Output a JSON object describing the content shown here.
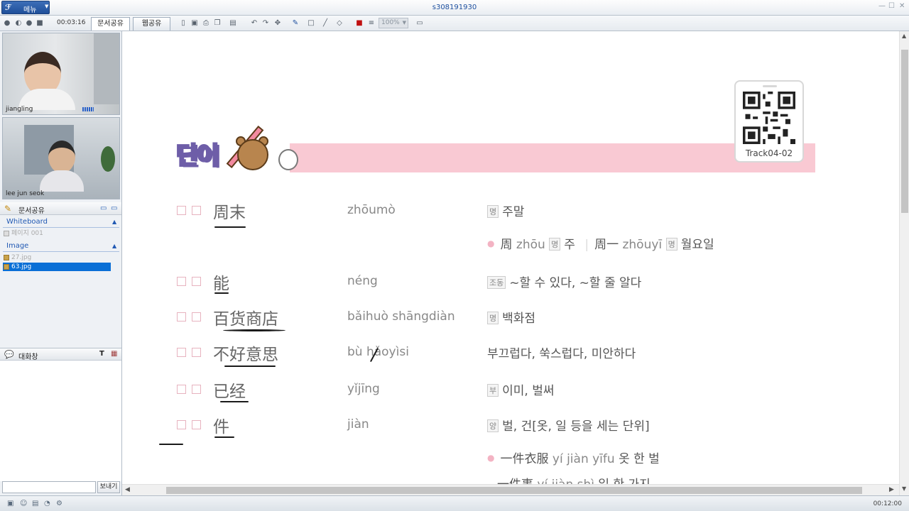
{
  "window": {
    "menu_label": "메뉴",
    "title": "s308191930"
  },
  "toolbar": {
    "elapsed": "00:03:16",
    "tab_doc_share": "문서공유",
    "tab_web_share": "웹공유",
    "zoom": "100%"
  },
  "participants": [
    {
      "name": "jiangling"
    },
    {
      "name": "lee jun seok"
    }
  ],
  "doc_panel": {
    "title": "문서공유",
    "whiteboard_label": "Whiteboard",
    "whiteboard_items": [
      "페이지 001"
    ],
    "image_label": "Image",
    "image_items": [
      "27.jpg",
      "63.jpg"
    ],
    "selected_item": "63.jpg"
  },
  "chat": {
    "title": "대화창",
    "send_label": "보내기"
  },
  "status": {
    "time": "00:12:00"
  },
  "document": {
    "heading": "단어",
    "qr_label": "Track04-02",
    "vocab": [
      {
        "hanzi": "周末",
        "pinyin": "zhōumò",
        "pos": "명",
        "meaning": "주말"
      },
      {
        "hanzi": "能",
        "pinyin": "néng",
        "pos": "조동",
        "meaning": "~할 수 있다, ~할 줄 알다"
      },
      {
        "hanzi": "百货商店",
        "pinyin": "bǎihuò shāngdiàn",
        "pos": "명",
        "meaning": "백화점"
      },
      {
        "hanzi": "不好意思",
        "pinyin": "bù hǎoyìsi",
        "pos": "",
        "meaning": "부끄럽다, 쑥스럽다, 미안하다"
      },
      {
        "hanzi": "已经",
        "pinyin": "yǐjīng",
        "pos": "부",
        "meaning": "이미, 벌써"
      },
      {
        "hanzi": "件",
        "pinyin": "jiàn",
        "pos": "양",
        "meaning": "벌, 건[옷, 일 등을 세는 단위]"
      }
    ],
    "sub_zhoumo": {
      "a_hanzi": "周",
      "a_pinyin": "zhōu",
      "a_pos": "명",
      "a_meaning": "주",
      "b_hanzi": "周一",
      "b_pinyin": "zhōuyī",
      "b_pos": "명",
      "b_meaning": "월요일"
    },
    "sub_jian": [
      {
        "hanzi": "一件衣服",
        "pinyin": "yí jiàn yīfu",
        "meaning": "옷 한 벌"
      },
      {
        "hanzi": "一件事",
        "pinyin": "yí jiàn shì",
        "meaning": "일 한 가지"
      }
    ]
  },
  "colors": {
    "accent": "#1f4f9a",
    "selection": "#0a6fd6",
    "pink_band": "#f9c9d3",
    "heading_purple": "#6e5ea8"
  }
}
